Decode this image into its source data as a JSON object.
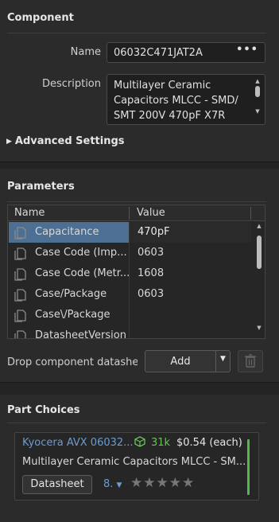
{
  "component": {
    "title": "Component",
    "name_label": "Name",
    "name_value": "06032C471JAT2A",
    "name_menu": "•••",
    "description_label": "Description",
    "description_value": "Multilayer Ceramic Capacitors MLCC - SMD/ SMT 200V 470pF X7R",
    "advanced_settings": "Advanced Settings"
  },
  "parameters": {
    "title": "Parameters",
    "columns": [
      "Name",
      "Value"
    ],
    "rows": [
      {
        "name": "Capacitance",
        "value": "470pF",
        "selected": true
      },
      {
        "name": "Case Code (Imp...",
        "value": "0603"
      },
      {
        "name": "Case Code (Metr...",
        "value": "1608"
      },
      {
        "name": "Case/Package",
        "value": "0603"
      },
      {
        "name": "Case\\/Package",
        "value": ""
      },
      {
        "name": "DatasheetVersion",
        "value": ""
      }
    ],
    "drop_text": "Drop component datashee",
    "add_label": "Add"
  },
  "part_choices": {
    "title": "Part Choices",
    "items": [
      {
        "manufacturer": "Kyocera AVX 06032...",
        "stock": "31k",
        "price": "$0.54 (each)",
        "description": "Multilayer Ceramic Capacitors MLCC - SM...",
        "datasheet_label": "Datasheet",
        "version": "8.",
        "rating": 0,
        "rating_max": 5
      }
    ]
  },
  "colors": {
    "background": "#2b2b2b",
    "selection": "#4d6f93",
    "link": "#6c9ccf",
    "stock": "#6dbf5e",
    "status_bar": "#53b84a"
  }
}
